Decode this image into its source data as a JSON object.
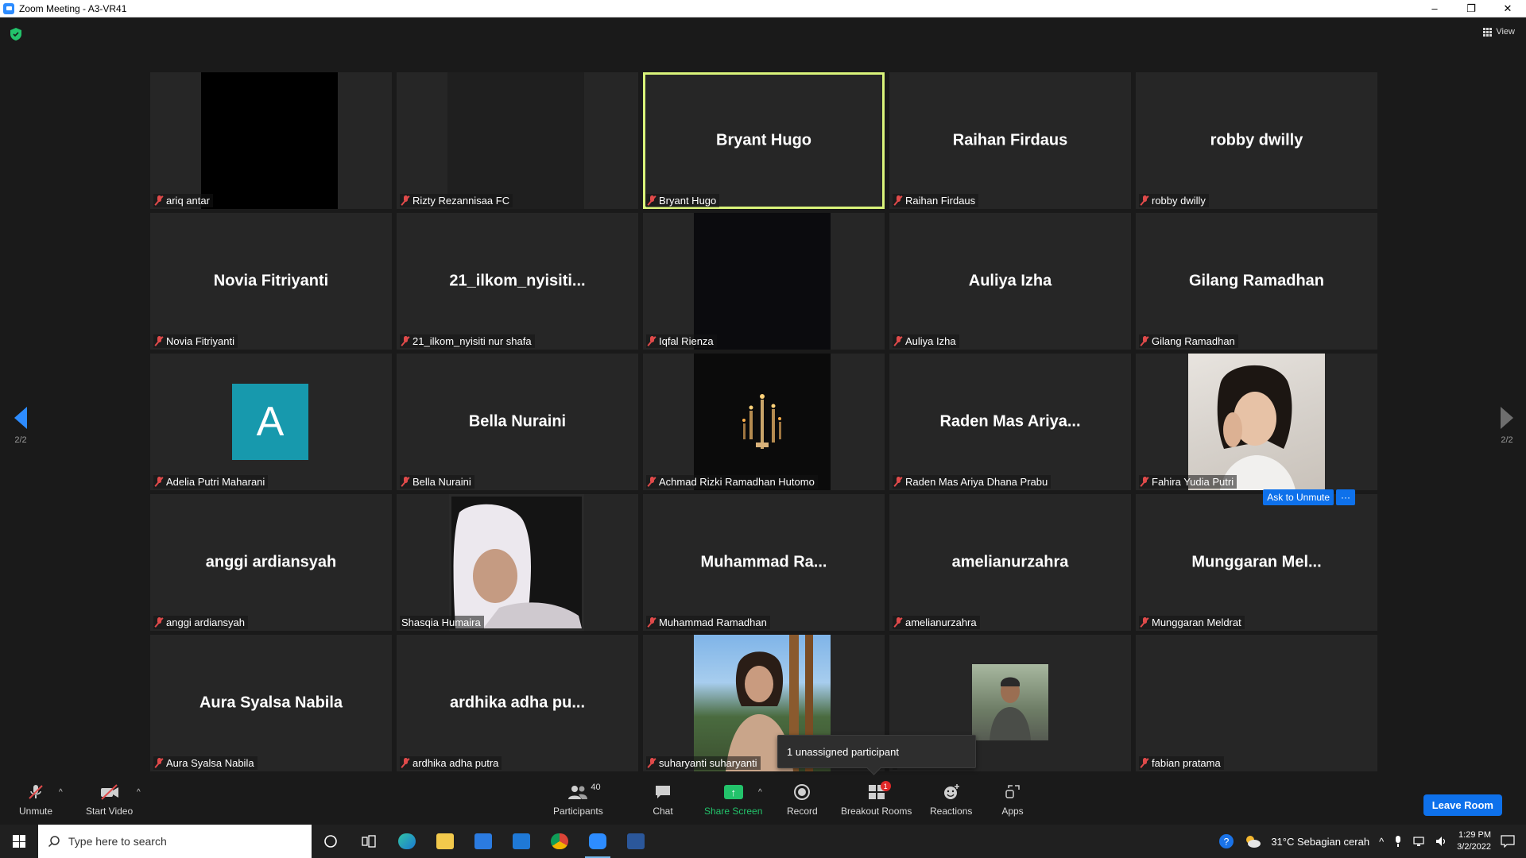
{
  "window": {
    "title": "Zoom Meeting - A3-VR41",
    "minimize": "–",
    "restore": "❐",
    "close": "✕"
  },
  "header": {
    "view_label": "View"
  },
  "pagination": {
    "left": "2/2",
    "right": "2/2"
  },
  "tiles": [
    {
      "big": "",
      "label": "ariq antar"
    },
    {
      "big": "",
      "label": "Rizty Rezannisaa FC"
    },
    {
      "big": "Bryant Hugo",
      "label": "Bryant Hugo"
    },
    {
      "big": "Raihan Firdaus",
      "label": "Raihan Firdaus"
    },
    {
      "big": "robby dwilly",
      "label": "robby dwilly"
    },
    {
      "big": "Novia Fitriyanti",
      "label": "Novia Fitriyanti"
    },
    {
      "big": "21_ilkom_nyisiti...",
      "label": "21_ilkom_nyisiti nur shafa"
    },
    {
      "big": "",
      "label": "Iqfal Rienza"
    },
    {
      "big": "Auliya Izha",
      "label": "Auliya Izha"
    },
    {
      "big": "Gilang Ramadhan",
      "label": "Gilang Ramadhan"
    },
    {
      "big": "",
      "label": "Adelia Putri Maharani",
      "avatar": "A"
    },
    {
      "big": "Bella Nuraini",
      "label": "Bella Nuraini"
    },
    {
      "big": "",
      "label": "Achmad Rizki Ramadhan Hutomo"
    },
    {
      "big": "Raden Mas Ariya...",
      "label": "Raden Mas Ariya Dhana Prabu"
    },
    {
      "big": "",
      "label": "Fahira Yudia Putri"
    },
    {
      "big": "anggi ardiansyah",
      "label": "anggi ardiansyah"
    },
    {
      "big": "",
      "label": "Shasqia Humaira"
    },
    {
      "big": "Muhammad  Ra...",
      "label": "Muhammad Ramadhan"
    },
    {
      "big": "amelianurzahra",
      "label": "amelianurzahra"
    },
    {
      "big": "Munggaran Mel...",
      "label": "Munggaran Meldrat"
    },
    {
      "big": "Aura Syalsa Nabila",
      "label": "Aura Syalsa Nabila"
    },
    {
      "big": "ardhika adha pu...",
      "label": "ardhika adha putra"
    },
    {
      "big": "",
      "label": "suharyanti suharyanti"
    },
    {
      "big": "",
      "label": ""
    },
    {
      "big": "",
      "label": "fabian pratama"
    }
  ],
  "hover_actions": {
    "ask_unmute": "Ask to Unmute",
    "more": "···"
  },
  "tooltip": {
    "unassigned": "1 unassigned participant"
  },
  "toolbar": {
    "unmute": "Unmute",
    "start_video": "Start Video",
    "participants": "Participants",
    "participants_count": "40",
    "chat": "Chat",
    "share_screen": "Share Screen",
    "record": "Record",
    "breakout_rooms": "Breakout Rooms",
    "breakout_badge": "1",
    "reactions": "Reactions",
    "apps": "Apps",
    "leave_room": "Leave Room"
  },
  "taskbar": {
    "search_placeholder": "Type here to search",
    "weather": "31°C  Sebagian cerah",
    "time": "1:29 PM",
    "date": "3/2/2022"
  },
  "colors": {
    "accent": "#0e71eb",
    "active_speaker": "#d9f37a",
    "share_green": "#23c36b",
    "muted_red": "#e04a4a"
  }
}
